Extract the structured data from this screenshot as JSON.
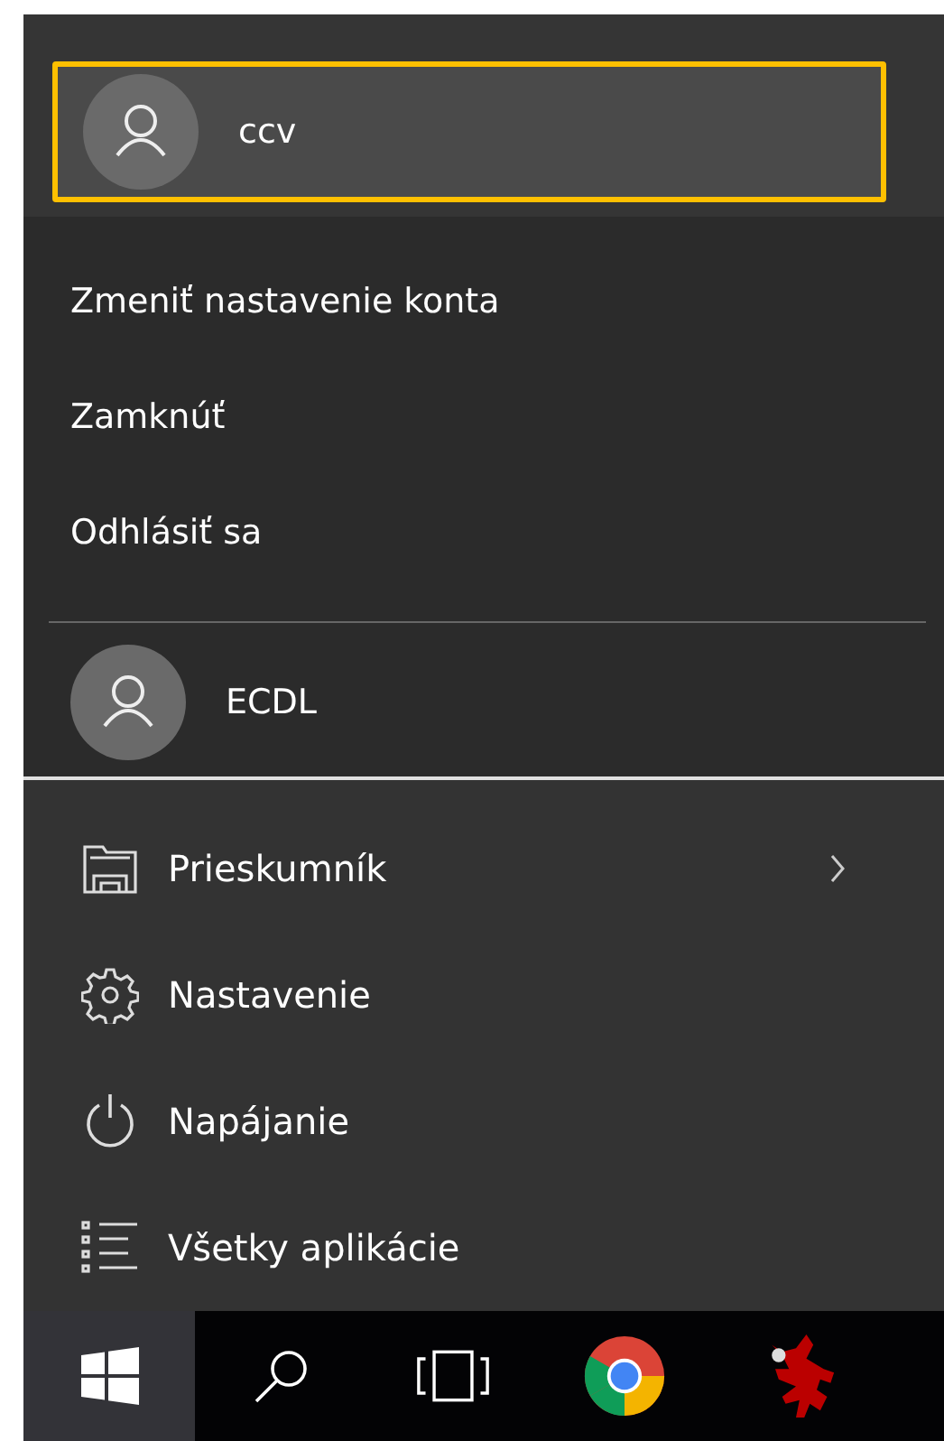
{
  "current_user": {
    "name": "ccv",
    "highlighted": true
  },
  "account_menu": {
    "items": [
      "Zmeniť nastavenie konta",
      "Zamknúť",
      "Odhlásiť sa"
    ],
    "other_users": [
      {
        "name": "ECDL"
      }
    ]
  },
  "start_menu": {
    "items": [
      {
        "kind": "folder",
        "label": "Prieskumník",
        "has_submenu": true
      },
      {
        "kind": "gear",
        "label": "Nastavenie",
        "has_submenu": false
      },
      {
        "kind": "power",
        "label": "Napájanie",
        "has_submenu": false
      },
      {
        "kind": "list",
        "label": "Všetky aplikácie",
        "has_submenu": false
      }
    ]
  },
  "taskbar": [
    {
      "kind": "start",
      "selected": true
    },
    {
      "kind": "search",
      "selected": false
    },
    {
      "kind": "taskview",
      "selected": false
    },
    {
      "kind": "browser",
      "selected": false
    },
    {
      "kind": "creature",
      "selected": false
    }
  ]
}
